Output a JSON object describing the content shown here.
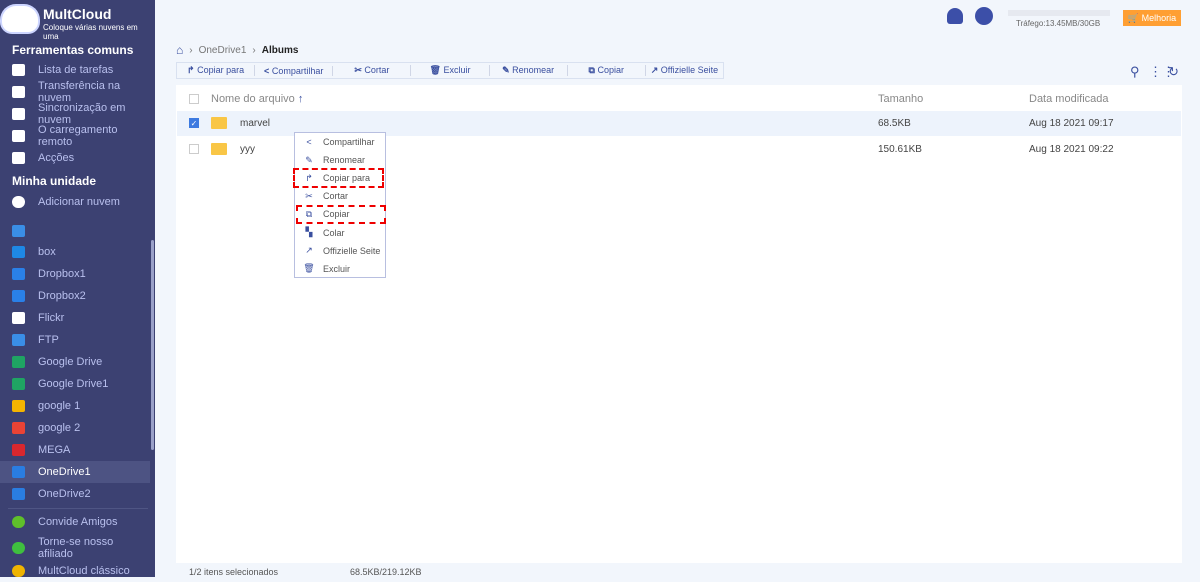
{
  "app": {
    "name": "MultCloud",
    "tagline": "Coloque várias nuvens em uma"
  },
  "sidebar": {
    "tools_header": "Ferramentas comuns",
    "tools": [
      {
        "label": "Lista de tarefas",
        "icon": "clipboard-icon"
      },
      {
        "label": "Transferência na nuvem",
        "icon": "cloud-transfer-icon"
      },
      {
        "label": "Sincronização em nuvem",
        "icon": "cloud-sync-icon"
      },
      {
        "label": "O carregamento remoto",
        "icon": "cloud-upload-icon"
      },
      {
        "label": "Acções",
        "icon": "cloud-share-icon"
      }
    ],
    "drive_header": "Minha unidade",
    "add_cloud": "Adicionar nuvem",
    "clouds": [
      {
        "label": "",
        "color": "#3a8ee6"
      },
      {
        "label": "box",
        "color": "#1e88e5"
      },
      {
        "label": "Dropbox1",
        "color": "#2a80e8"
      },
      {
        "label": "Dropbox2",
        "color": "#2a80e8"
      },
      {
        "label": "Flickr",
        "color": "#ffffff"
      },
      {
        "label": "FTP",
        "color": "#3a8ee6"
      },
      {
        "label": "Google Drive",
        "color": "#1fa463"
      },
      {
        "label": "Google Drive1",
        "color": "#1fa463"
      },
      {
        "label": "google 1",
        "color": "#f4b400"
      },
      {
        "label": "google 2",
        "color": "#ea4335"
      },
      {
        "label": "MEGA",
        "color": "#d9272e"
      },
      {
        "label": "OneDrive1",
        "color": "#2a7de1",
        "active": true
      },
      {
        "label": "OneDrive2",
        "color": "#2a7de1"
      }
    ],
    "extras": [
      {
        "label": "Convide Amigos",
        "color": "#5fbf2a"
      },
      {
        "label": "Torne-se nosso afiliado",
        "color": "#3fbf3f"
      },
      {
        "label": "MultCloud clássico",
        "color": "#f0b400"
      }
    ]
  },
  "header": {
    "traffic": "Tráfego:13.45MB/30GB",
    "upgrade": "Melhoria"
  },
  "breadcrumb": [
    "OneDrive1",
    "Albums"
  ],
  "toolbar": [
    "Copiar para",
    "Compartilhar",
    "Cortar",
    "Excluir",
    "Renomear",
    "Copiar",
    "Offizielle Seite"
  ],
  "toolbar_icons": [
    "↱",
    "<",
    "✂",
    "🗑",
    "✎",
    "⧉",
    "↗"
  ],
  "columns": {
    "name": "Nome do arquivo",
    "size": "Tamanho",
    "date": "Data modificada",
    "sort": "↑"
  },
  "files": [
    {
      "name": "marvel",
      "size": "68.5KB",
      "date": "Aug 18 2021 09:17",
      "checked": true
    },
    {
      "name": "yyy",
      "size": "150.61KB",
      "date": "Aug 18 2021 09:22",
      "checked": false
    }
  ],
  "context_menu": [
    {
      "label": "Compartilhar",
      "icon": "<"
    },
    {
      "label": "Renomear",
      "icon": "✎"
    },
    {
      "label": "Copiar para",
      "icon": "↱"
    },
    {
      "label": "Cortar",
      "icon": "✂"
    },
    {
      "label": "Copiar",
      "icon": "⧉"
    },
    {
      "label": "Colar",
      "icon": "▚"
    },
    {
      "label": "Offizielle Seite",
      "icon": "↗"
    },
    {
      "label": "Excluir",
      "icon": "🗑"
    }
  ],
  "footer": {
    "selected": "1/2 itens selecionados",
    "size": "68.5KB/219.12KB"
  }
}
